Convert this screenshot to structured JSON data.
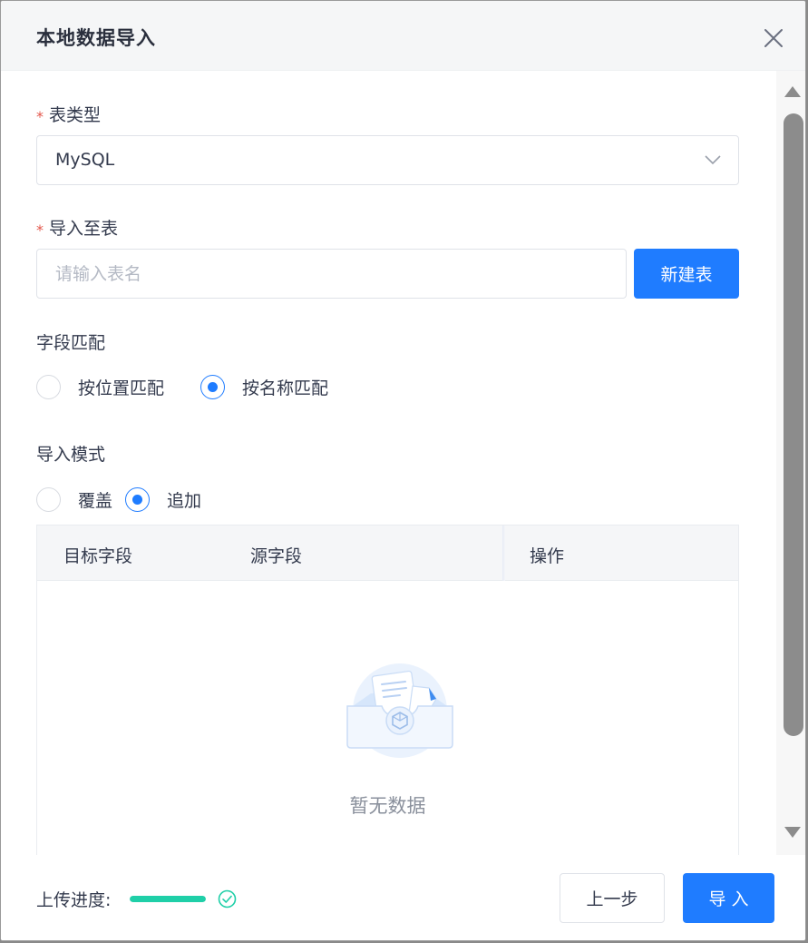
{
  "dialog": {
    "title": "本地数据导入"
  },
  "form": {
    "table_type": {
      "label": "表类型",
      "value": "MySQL"
    },
    "target_table": {
      "label": "导入至表",
      "placeholder": "请输入表名",
      "new_table_label": "新建表"
    },
    "field_match": {
      "label": "字段匹配",
      "options": [
        {
          "label": "按位置匹配",
          "checked": false
        },
        {
          "label": "按名称匹配",
          "checked": true
        }
      ]
    },
    "import_mode": {
      "label": "导入模式",
      "options": [
        {
          "label": "覆盖",
          "checked": false
        },
        {
          "label": "追加",
          "checked": true
        }
      ]
    }
  },
  "table": {
    "columns": [
      "目标字段",
      "源字段",
      "操作"
    ],
    "empty_text": "暂无数据"
  },
  "footer": {
    "progress_label": "上传进度:",
    "progress": 1.0,
    "prev_label": "上一步",
    "import_label": "导 入"
  },
  "colors": {
    "primary": "#1f7cff",
    "success": "#1fcfa8",
    "required": "#e4574b"
  },
  "icons": {
    "close": "close-icon",
    "dropdown": "chevron-down-icon",
    "success": "check-circle-icon",
    "empty": "empty-box-icon"
  }
}
